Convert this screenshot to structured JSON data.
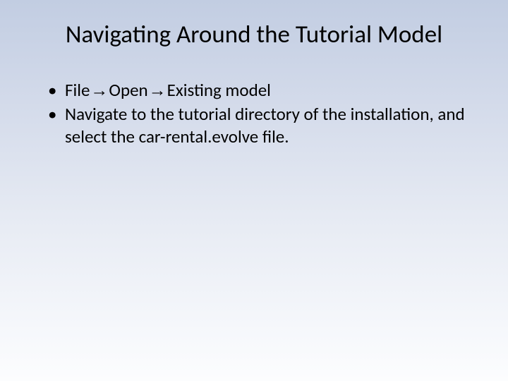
{
  "slide": {
    "title": "Navigating Around the Tutorial Model",
    "bullets": [
      {
        "seg1": "File",
        "arrow1": "→",
        "seg2": "Open",
        "arrow2": "→",
        "seg3": "Existing model"
      },
      {
        "pre": "Navigate to the tutorial directory of the installation, and select the ",
        "filename": "car-rental.evolve",
        "post": " file."
      }
    ]
  }
}
